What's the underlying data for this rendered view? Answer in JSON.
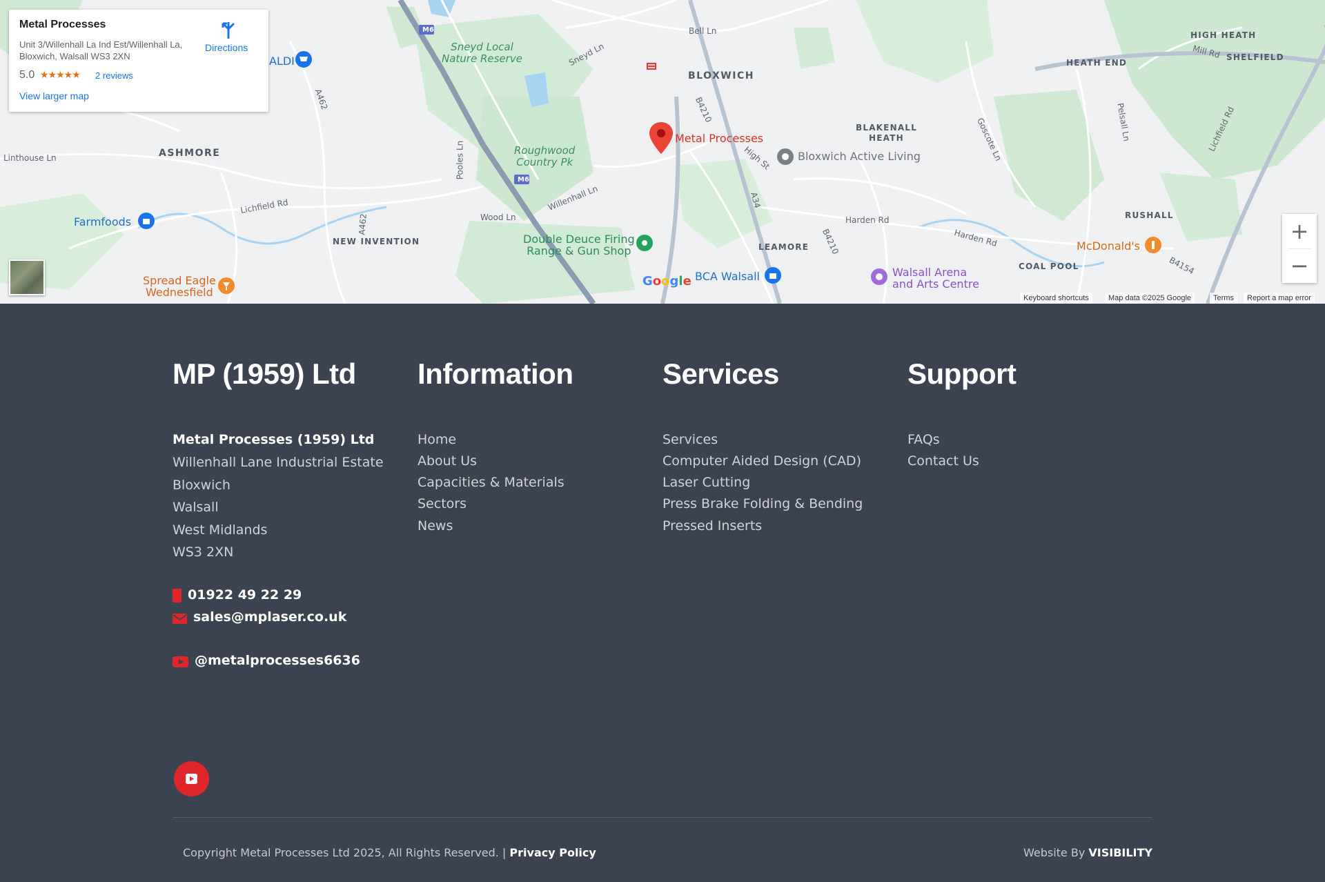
{
  "map": {
    "info_card": {
      "title": "Metal Processes",
      "address": "Unit 3/Willenhall La Ind Est/Willenhall La, Bloxwich, Walsall WS3 2XN",
      "rating": "5.0",
      "stars": "★★★★★",
      "reviews": "2 reviews",
      "larger_map": "View larger map",
      "directions": "Directions"
    },
    "labels": {
      "bloxwich": "BLOXWICH",
      "ashmore": "ASHMORE",
      "blakenall": "BLAKENALL",
      "heath": "HEATH",
      "new_invention": "NEW INVENTION",
      "leamore": "LEAMORE",
      "coal_pool": "COAL POOL",
      "rushall": "RUSHALL",
      "high_heath": "HIGH HEATH",
      "heath_end": "HEATH END",
      "shelfield": "SHELFIELD",
      "sneyd_1": "Sneyd Local",
      "sneyd_2": "Nature Reserve",
      "roughwood_1": "Roughwood",
      "roughwood_2": "Country Pk",
      "metal_processes": "Metal Processes",
      "bloxwich_active": "Bloxwich Active Living",
      "farmfoods": "Farmfoods",
      "spread_eagle_1": "Spread Eagle",
      "spread_eagle_2": "Wednesfield",
      "double_deuce_1": "Double Deuce Firing",
      "double_deuce_2": "Range & Gun Shop",
      "bca_walsall": "BCA Walsall",
      "walsall_arena_1": "Walsall Arena",
      "walsall_arena_2": "and Arts Centre",
      "mcdonalds": "McDonald's",
      "aldi": "ALDI",
      "harden_rd": "Harden Rd",
      "harden_rd_2": "Harden Rd",
      "lichfield_rd": "Lichfield Rd",
      "linthouse": "Linthouse Ln",
      "wood_ln": "Wood Ln",
      "willenhall_ln": "Willenhall Ln",
      "sneyd_ln": "Sneyd Ln",
      "bell_ln": "Bell Ln",
      "high_st": "High St",
      "poolesln": "Pooles Ln",
      "a462": "A462",
      "a462b": "A462",
      "a34": "A34",
      "b4210": "B4210",
      "b4210b": "B4210",
      "b4154": "B4154",
      "m6": "M6",
      "m6b": "M6",
      "goscote": "Goscote Ln",
      "pelsall": "Pelsall Ln",
      "mill_rd": "Mill Rd",
      "lichfield_rd_e": "Lichfield Rd"
    },
    "google": "Google",
    "attribution": {
      "shortcuts": "Keyboard shortcuts",
      "data": "Map data ©2025 Google",
      "terms": "Terms",
      "report": "Report a map error"
    },
    "zoom_in": "+",
    "zoom_out": "−"
  },
  "footer": {
    "col1": {
      "heading": "MP (1959) Ltd",
      "company": "Metal Processes (1959) Ltd",
      "address": [
        "Willenhall Lane Industrial Estate",
        "Bloxwich",
        "Walsall",
        "West Midlands",
        "WS3 2XN"
      ],
      "phone": "01922 49 22 29",
      "email": "sales@mplaser.co.uk",
      "youtube": "@metalprocesses6636"
    },
    "col2": {
      "heading": "Information",
      "links": [
        "Home",
        "About Us",
        "Capacities & Materials",
        "Sectors",
        "News"
      ]
    },
    "col3": {
      "heading": "Services",
      "links": [
        "Services",
        "Computer Aided Design (CAD)",
        "Laser Cutting",
        "Press Brake Folding & Bending",
        "Pressed Inserts"
      ]
    },
    "col4": {
      "heading": "Support",
      "links": [
        "FAQs",
        "Contact Us"
      ]
    },
    "copyright": "Copyright Metal Processes Ltd 2025, All Rights Reserved. |",
    "privacy": "Privacy Policy",
    "credit_prefix": "Website By",
    "credit_brand": "VISIBILITY",
    "colors": {
      "bg": "#3c4350",
      "accent": "#e0262b"
    },
    "icons": {
      "phone": "phone-icon",
      "email": "envelope-icon",
      "youtube": "youtube-icon"
    }
  }
}
